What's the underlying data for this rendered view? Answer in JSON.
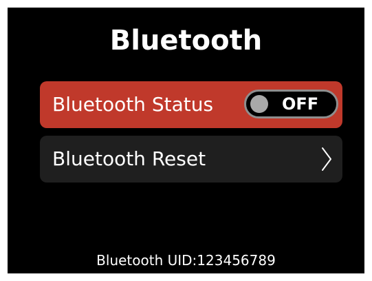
{
  "screen": {
    "title": "Bluetooth",
    "background": "#000000"
  },
  "menu": {
    "status_row": {
      "label": "Bluetooth Status",
      "background": "#c0392b",
      "toggle": {
        "state_label": "OFF",
        "is_on": false
      }
    },
    "reset_row": {
      "label": "Bluetooth Reset",
      "background": "#1f1f1f",
      "icon": "chevron-right-icon"
    }
  },
  "footer": {
    "uid_text": "Bluetooth UID:123456789"
  }
}
